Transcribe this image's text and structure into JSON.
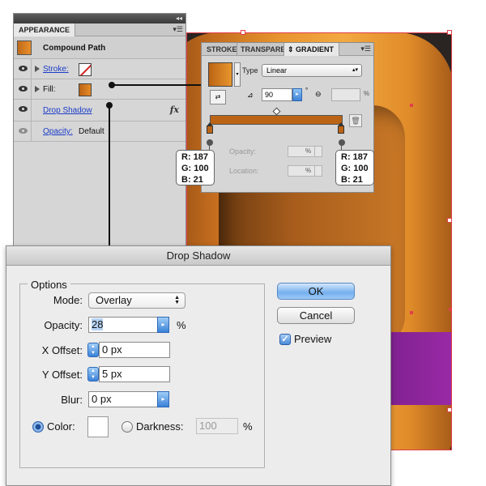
{
  "appearance_panel": {
    "tab_label": "APPEARANCE",
    "object_label": "Compound Path",
    "stroke_label": "Stroke:",
    "fill_label": "Fill:",
    "effect_label": "Drop Shadow",
    "effect_icon": "fx",
    "opacity_label": "Opacity:",
    "opacity_value": "Default"
  },
  "gradient_panel": {
    "tabs": [
      "STROKE",
      "TRANSPARE",
      "GRADIENT"
    ],
    "type_label": "Type",
    "type_value": "Linear",
    "angle_value": "90",
    "degree_symbol": "°",
    "aspect_unit": "%",
    "opacity_label": "Opacity:",
    "opacity_unit": "%",
    "location_label": "Location:",
    "location_unit": "%"
  },
  "callouts": {
    "left": [
      "R: 187",
      "G: 100",
      "B: 21"
    ],
    "right": [
      "R: 187",
      "G: 100",
      "B: 21"
    ]
  },
  "drop_shadow_dialog": {
    "title": "Drop Shadow",
    "group_title": "Options",
    "mode_label": "Mode:",
    "mode_value": "Overlay",
    "opacity_label": "Opacity:",
    "opacity_value": "28",
    "opacity_unit": "%",
    "x_offset_label": "X Offset:",
    "x_offset_value": "0 px",
    "y_offset_label": "Y Offset:",
    "y_offset_value": "5 px",
    "blur_label": "Blur:",
    "blur_value": "0 px",
    "color_label": "Color:",
    "darkness_label": "Darkness:",
    "darkness_value": "100",
    "darkness_unit": "%",
    "ok_label": "OK",
    "cancel_label": "Cancel",
    "preview_label": "Preview",
    "preview_checked": true
  },
  "colors": {
    "gradient_start": "#BB6415",
    "gradient_end": "#BB6415",
    "accent_blue": "#3A82D8",
    "artwork_purple": "#9B2AA8",
    "selection_red": "#E0404A"
  }
}
